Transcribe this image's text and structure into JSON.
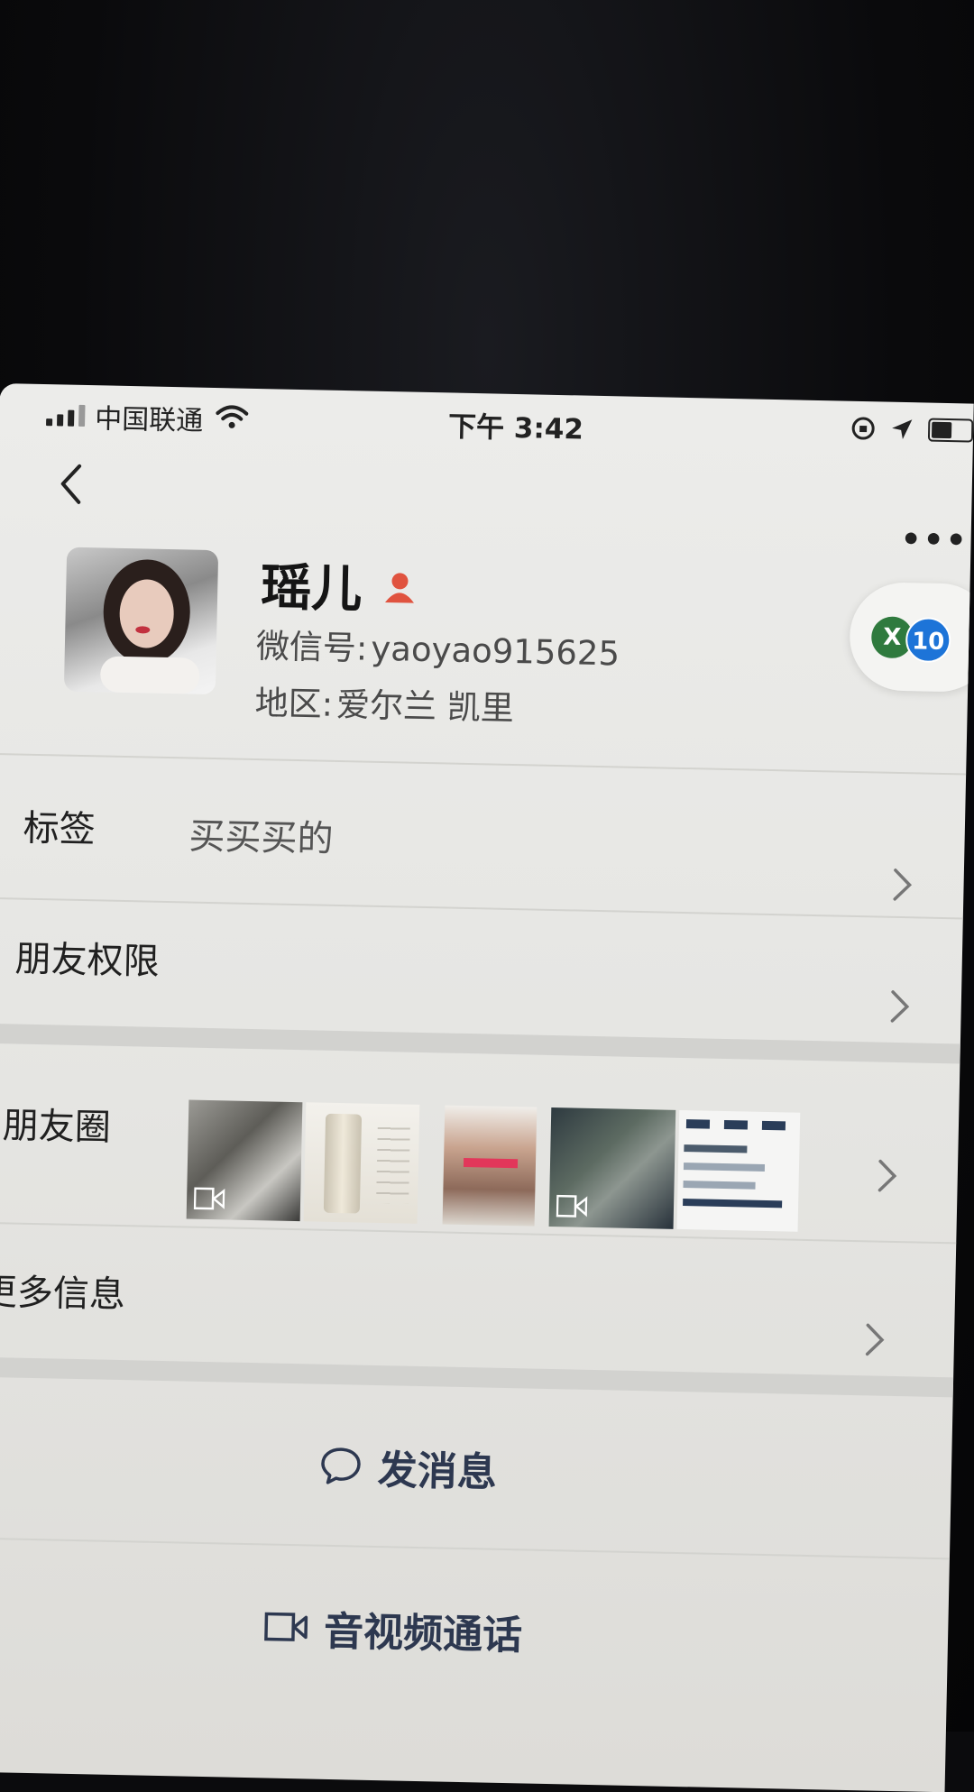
{
  "status_bar": {
    "carrier": "中国联通",
    "time": "下午 3:42"
  },
  "nav": {
    "back_icon": "chevron-left-icon",
    "more_label": "•••"
  },
  "profile": {
    "name": "瑶儿",
    "wechat_id_label": "微信号:",
    "wechat_id": "yaoyao915625",
    "region_label": "地区:",
    "region": "爱尔兰 凯里",
    "gender_icon": "female-icon",
    "wecom_badge": {
      "left": "X",
      "right": "10"
    }
  },
  "rows": {
    "tags_label": "标签",
    "tags_value": "买买买的",
    "permissions_label": "朋友权限",
    "moments_label": "朋友圈",
    "more_info_label": "更多信息"
  },
  "actions": {
    "message_label": "发消息",
    "call_label": "音视频通话"
  },
  "colors": {
    "accent_text": "#2d3850",
    "gender": "#e0533f",
    "wecom_green": "#2f7a3e",
    "wecom_blue": "#1d74d8"
  }
}
